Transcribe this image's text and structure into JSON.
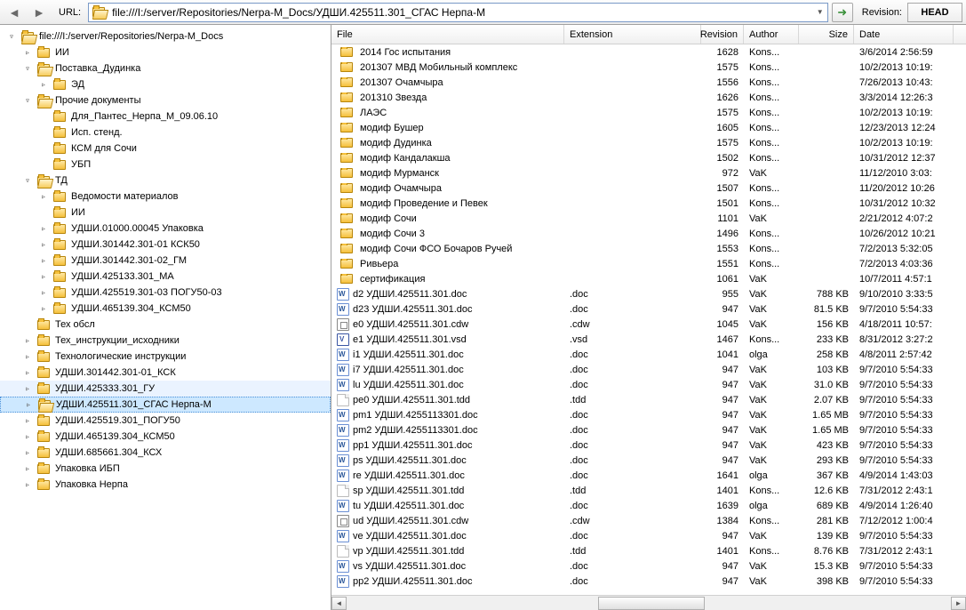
{
  "toolbar": {
    "url_label": "URL:",
    "url_value": "file:///I:/server/Repositories/Nerpa-M_Docs/УДШИ.425511.301_СГАС Нерпа-М",
    "revision_label": "Revision:",
    "revision_value": "HEAD"
  },
  "tree": [
    {
      "d": 0,
      "exp": "▿",
      "ico": "open",
      "label": "file:///I:/server/Repositories/Nerpa-M_Docs"
    },
    {
      "d": 1,
      "exp": "▹",
      "ico": "closed",
      "label": "ИИ"
    },
    {
      "d": 1,
      "exp": "▿",
      "ico": "open",
      "label": "Поставка_Дудинка"
    },
    {
      "d": 2,
      "exp": "▹",
      "ico": "closed",
      "label": "ЭД"
    },
    {
      "d": 1,
      "exp": "▿",
      "ico": "open",
      "label": "Прочие документы"
    },
    {
      "d": 2,
      "exp": "",
      "ico": "closed",
      "label": "Для_Пантес_Нерпа_М_09.06.10"
    },
    {
      "d": 2,
      "exp": "",
      "ico": "closed",
      "label": "Исп. стенд."
    },
    {
      "d": 2,
      "exp": "",
      "ico": "closed",
      "label": "КСМ для Сочи"
    },
    {
      "d": 2,
      "exp": "",
      "ico": "closed",
      "label": "УБП"
    },
    {
      "d": 1,
      "exp": "▿",
      "ico": "open",
      "label": "ТД"
    },
    {
      "d": 2,
      "exp": "▹",
      "ico": "closed",
      "label": "Ведомости материалов"
    },
    {
      "d": 2,
      "exp": "",
      "ico": "closed",
      "label": "ИИ"
    },
    {
      "d": 2,
      "exp": "▹",
      "ico": "closed",
      "label": "УДШИ.01000.00045 Упаковка"
    },
    {
      "d": 2,
      "exp": "▹",
      "ico": "closed",
      "label": "УДШИ.301442.301-01 КСК50"
    },
    {
      "d": 2,
      "exp": "▹",
      "ico": "closed",
      "label": "УДШИ.301442.301-02_ГМ"
    },
    {
      "d": 2,
      "exp": "▹",
      "ico": "closed",
      "label": "УДШИ.425133.301_МА"
    },
    {
      "d": 2,
      "exp": "▹",
      "ico": "closed",
      "label": "УДШИ.425519.301-03 ПОГУ50-03"
    },
    {
      "d": 2,
      "exp": "▹",
      "ico": "closed",
      "label": "УДШИ.465139.304_КСМ50"
    },
    {
      "d": 1,
      "exp": "",
      "ico": "closed",
      "label": "Тех обсл"
    },
    {
      "d": 1,
      "exp": "▹",
      "ico": "closed",
      "label": "Тех_инструкции_исходники"
    },
    {
      "d": 1,
      "exp": "▹",
      "ico": "closed",
      "label": "Технологические инструкции"
    },
    {
      "d": 1,
      "exp": "▹",
      "ico": "closed",
      "label": "УДШИ.301442.301-01_КСК"
    },
    {
      "d": 1,
      "exp": "▹",
      "ico": "closed",
      "label": "УДШИ.425333.301_ГУ",
      "hov": true
    },
    {
      "d": 1,
      "exp": "▹",
      "ico": "open",
      "label": "УДШИ.425511.301_СГАС Нерпа-М",
      "sel": true
    },
    {
      "d": 1,
      "exp": "▹",
      "ico": "closed",
      "label": "УДШИ.425519.301_ПОГУ50"
    },
    {
      "d": 1,
      "exp": "▹",
      "ico": "closed",
      "label": "УДШИ.465139.304_КСМ50"
    },
    {
      "d": 1,
      "exp": "▹",
      "ico": "closed",
      "label": "УДШИ.685661.304_КСХ"
    },
    {
      "d": 1,
      "exp": "▹",
      "ico": "closed",
      "label": "Упаковка ИБП"
    },
    {
      "d": 1,
      "exp": "▹",
      "ico": "closed",
      "label": "Упаковка Нерпа"
    }
  ],
  "headers": {
    "file": "File",
    "ext": "Extension",
    "rev": "Revision",
    "author": "Author",
    "size": "Size",
    "date": "Date"
  },
  "rows": [
    {
      "ico": "folder",
      "file": "2014 Гос испытания",
      "ext": "",
      "rev": "1628",
      "author": "Kons...",
      "size": "",
      "date": "3/6/2014 2:56:59"
    },
    {
      "ico": "folder",
      "file": "201307 МВД Мобильный комплекс",
      "ext": "",
      "rev": "1575",
      "author": "Kons...",
      "size": "",
      "date": "10/2/2013 10:19:"
    },
    {
      "ico": "folder",
      "file": "201307 Очамчыра",
      "ext": "",
      "rev": "1556",
      "author": "Kons...",
      "size": "",
      "date": "7/26/2013 10:43:"
    },
    {
      "ico": "folder",
      "file": "201310 Звезда",
      "ext": "",
      "rev": "1626",
      "author": "Kons...",
      "size": "",
      "date": "3/3/2014 12:26:3"
    },
    {
      "ico": "folder",
      "file": "ЛАЭС",
      "ext": "",
      "rev": "1575",
      "author": "Kons...",
      "size": "",
      "date": "10/2/2013 10:19:"
    },
    {
      "ico": "folder",
      "file": "модиф Бушер",
      "ext": "",
      "rev": "1605",
      "author": "Kons...",
      "size": "",
      "date": "12/23/2013 12:24"
    },
    {
      "ico": "folder",
      "file": "модиф Дудинка",
      "ext": "",
      "rev": "1575",
      "author": "Kons...",
      "size": "",
      "date": "10/2/2013 10:19:"
    },
    {
      "ico": "folder",
      "file": "модиф Кандалакша",
      "ext": "",
      "rev": "1502",
      "author": "Kons...",
      "size": "",
      "date": "10/31/2012 12:37"
    },
    {
      "ico": "folder",
      "file": "модиф Мурманск",
      "ext": "",
      "rev": "972",
      "author": "VaK",
      "size": "",
      "date": "11/12/2010 3:03:"
    },
    {
      "ico": "folder",
      "file": "модиф Очамчыра",
      "ext": "",
      "rev": "1507",
      "author": "Kons...",
      "size": "",
      "date": "11/20/2012 10:26"
    },
    {
      "ico": "folder",
      "file": "модиф Проведение и Певек",
      "ext": "",
      "rev": "1501",
      "author": "Kons...",
      "size": "",
      "date": "10/31/2012 10:32"
    },
    {
      "ico": "folder",
      "file": "модиф Сочи",
      "ext": "",
      "rev": "1101",
      "author": "VaK",
      "size": "",
      "date": "2/21/2012 4:07:2"
    },
    {
      "ico": "folder",
      "file": "модиф Сочи 3",
      "ext": "",
      "rev": "1496",
      "author": "Kons...",
      "size": "",
      "date": "10/26/2012 10:21"
    },
    {
      "ico": "folder",
      "file": "модиф Сочи ФСО Бочаров Ручей",
      "ext": "",
      "rev": "1553",
      "author": "Kons...",
      "size": "",
      "date": "7/2/2013 5:32:05"
    },
    {
      "ico": "folder",
      "file": "Ривьера",
      "ext": "",
      "rev": "1551",
      "author": "Kons...",
      "size": "",
      "date": "7/2/2013 4:03:36"
    },
    {
      "ico": "folder",
      "file": "сертификация",
      "ext": "",
      "rev": "1061",
      "author": "VaK",
      "size": "",
      "date": "10/7/2011 4:57:1"
    },
    {
      "ico": "doc",
      "file": "d2 УДШИ.425511.301.doc",
      "ext": ".doc",
      "rev": "955",
      "author": "VaK",
      "size": "788 KB",
      "date": "9/10/2010 3:33:5"
    },
    {
      "ico": "doc",
      "file": "d23 УДШИ.425511.301.doc",
      "ext": ".doc",
      "rev": "947",
      "author": "VaK",
      "size": "81.5 KB",
      "date": "9/7/2010 5:54:33"
    },
    {
      "ico": "cdw",
      "file": "e0 УДШИ.425511.301.cdw",
      "ext": ".cdw",
      "rev": "1045",
      "author": "VaK",
      "size": "156 KB",
      "date": "4/18/2011 10:57:"
    },
    {
      "ico": "visio",
      "file": "e1 УДШИ.425511.301.vsd",
      "ext": ".vsd",
      "rev": "1467",
      "author": "Kons...",
      "size": "233 KB",
      "date": "8/31/2012 3:27:2"
    },
    {
      "ico": "doc",
      "file": "i1 УДШИ.425511.301.doc",
      "ext": ".doc",
      "rev": "1041",
      "author": "olga",
      "size": "258 KB",
      "date": "4/8/2011 2:57:42"
    },
    {
      "ico": "doc",
      "file": "i7 УДШИ.425511.301.doc",
      "ext": ".doc",
      "rev": "947",
      "author": "VaK",
      "size": "103 KB",
      "date": "9/7/2010 5:54:33"
    },
    {
      "ico": "doc",
      "file": "lu УДШИ.425511.301.doc",
      "ext": ".doc",
      "rev": "947",
      "author": "VaK",
      "size": "31.0 KB",
      "date": "9/7/2010 5:54:33"
    },
    {
      "ico": "blank",
      "file": "pe0 УДШИ.425511.301.tdd",
      "ext": ".tdd",
      "rev": "947",
      "author": "VaK",
      "size": "2.07 KB",
      "date": "9/7/2010 5:54:33"
    },
    {
      "ico": "doc",
      "file": "pm1 УДШИ.4255113301.doc",
      "ext": ".doc",
      "rev": "947",
      "author": "VaK",
      "size": "1.65 MB",
      "date": "9/7/2010 5:54:33"
    },
    {
      "ico": "doc",
      "file": "pm2 УДШИ.4255113301.doc",
      "ext": ".doc",
      "rev": "947",
      "author": "VaK",
      "size": "1.65 MB",
      "date": "9/7/2010 5:54:33"
    },
    {
      "ico": "doc",
      "file": "pp1 УДШИ.425511.301.doc",
      "ext": ".doc",
      "rev": "947",
      "author": "VaK",
      "size": "423 KB",
      "date": "9/7/2010 5:54:33"
    },
    {
      "ico": "doc",
      "file": "ps УДШИ.425511.301.doc",
      "ext": ".doc",
      "rev": "947",
      "author": "VaK",
      "size": "293 KB",
      "date": "9/7/2010 5:54:33"
    },
    {
      "ico": "doc",
      "file": "re УДШИ.425511.301.doc",
      "ext": ".doc",
      "rev": "1641",
      "author": "olga",
      "size": "367 KB",
      "date": "4/9/2014 1:43:03"
    },
    {
      "ico": "blank",
      "file": "sp УДШИ.425511.301.tdd",
      "ext": ".tdd",
      "rev": "1401",
      "author": "Kons...",
      "size": "12.6 KB",
      "date": "7/31/2012 2:43:1"
    },
    {
      "ico": "doc",
      "file": "tu УДШИ.425511.301.doc",
      "ext": ".doc",
      "rev": "1639",
      "author": "olga",
      "size": "689 KB",
      "date": "4/9/2014 1:26:40"
    },
    {
      "ico": "cdw",
      "file": "ud УДШИ.425511.301.cdw",
      "ext": ".cdw",
      "rev": "1384",
      "author": "Kons...",
      "size": "281 KB",
      "date": "7/12/2012 1:00:4"
    },
    {
      "ico": "doc",
      "file": "ve УДШИ.425511.301.doc",
      "ext": ".doc",
      "rev": "947",
      "author": "VaK",
      "size": "139 KB",
      "date": "9/7/2010 5:54:33"
    },
    {
      "ico": "blank",
      "file": "vp УДШИ.425511.301.tdd",
      "ext": ".tdd",
      "rev": "1401",
      "author": "Kons...",
      "size": "8.76 KB",
      "date": "7/31/2012 2:43:1"
    },
    {
      "ico": "doc",
      "file": "vs УДШИ.425511.301.doc",
      "ext": ".doc",
      "rev": "947",
      "author": "VaK",
      "size": "15.3 KB",
      "date": "9/7/2010 5:54:33"
    },
    {
      "ico": "doc",
      "file": "pp2 УДШИ.425511.301.doc",
      "ext": ".doc",
      "rev": "947",
      "author": "VaK",
      "size": "398 KB",
      "date": "9/7/2010 5:54:33"
    }
  ]
}
